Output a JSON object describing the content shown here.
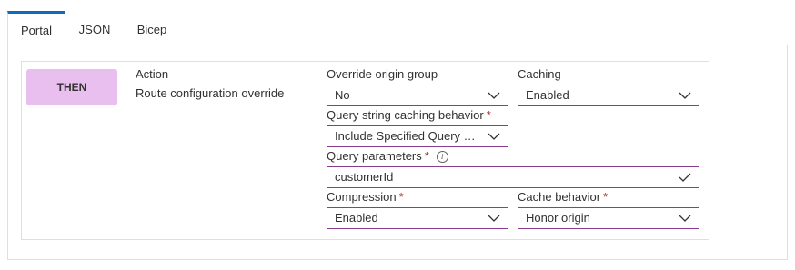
{
  "tabs": [
    {
      "label": "Portal",
      "active": true
    },
    {
      "label": "JSON",
      "active": false
    },
    {
      "label": "Bicep",
      "active": false
    }
  ],
  "rule": {
    "badge": "THEN",
    "action_label": "Action",
    "action_value": "Route configuration override"
  },
  "fields": {
    "override_origin_group": {
      "label": "Override origin group",
      "value": "No"
    },
    "caching": {
      "label": "Caching",
      "value": "Enabled"
    },
    "query_string_caching": {
      "label": "Query string caching behavior",
      "required": "*",
      "value": "Include Specified Query St..."
    },
    "query_parameters": {
      "label": "Query parameters",
      "required": "*",
      "info": "i",
      "value": "customerId"
    },
    "compression": {
      "label": "Compression",
      "required": "*",
      "value": "Enabled"
    },
    "cache_behavior": {
      "label": "Cache behavior",
      "required": "*",
      "value": "Honor origin"
    }
  },
  "colors": {
    "accent": "#0f6cbd",
    "badge": "#e9bff0",
    "field_border": "#8a3c8f",
    "required": "#a4262c"
  }
}
